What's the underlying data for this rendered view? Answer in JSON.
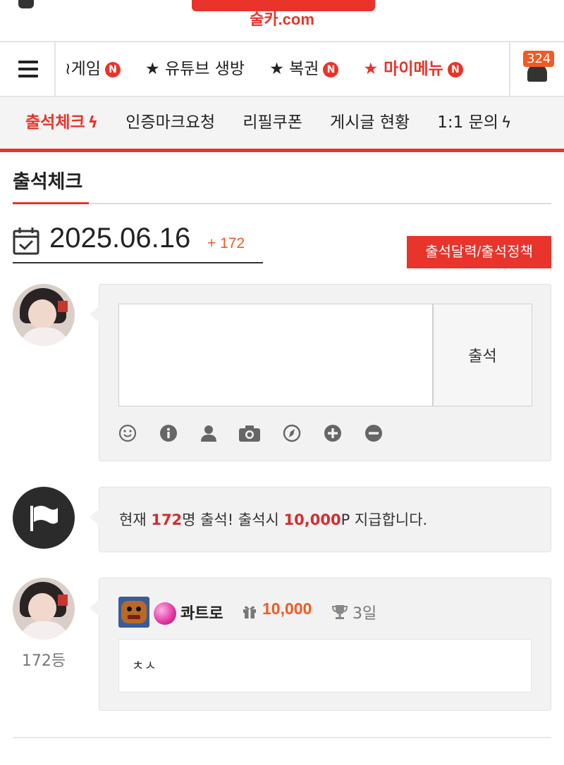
{
  "brand": {
    "domain": "술카.com",
    "accent": "#e8342a"
  },
  "nav1": {
    "items": [
      {
        "label": "≀게임",
        "new": "N",
        "highlight": false
      },
      {
        "label": "★ 유튜브 생방",
        "new": "",
        "highlight": false
      },
      {
        "label": "★ 복권",
        "new": "N",
        "highlight": false
      },
      {
        "label": "★ 마이메뉴",
        "new": "N",
        "highlight": true
      }
    ],
    "notification_count": "324"
  },
  "nav2": {
    "items": [
      {
        "label": "출석체크",
        "active": true,
        "bolt": true
      },
      {
        "label": "인증마크요청",
        "active": false,
        "bolt": false
      },
      {
        "label": "리필쿠폰",
        "active": false,
        "bolt": false
      },
      {
        "label": "게시글 현황",
        "active": false,
        "bolt": false
      },
      {
        "label": "1:1 문의",
        "active": false,
        "bolt": true
      }
    ]
  },
  "page": {
    "title": "출석체크",
    "date": "2025.06.16",
    "count_delta": "+ 172",
    "policy_button": "출석달력/출석정책"
  },
  "attendance_form": {
    "input_value": "",
    "submit_label": "출석",
    "tools": [
      "smile-icon",
      "info-icon",
      "user-icon",
      "camera-icon",
      "compass-icon",
      "plus-circle-icon",
      "minus-circle-icon"
    ]
  },
  "notice": {
    "prefix": "현재 ",
    "count": "172",
    "middle": "명 출석! 출석시 ",
    "points": "10,000",
    "suffix": "P 지급합니다."
  },
  "entries": [
    {
      "rank": "172등",
      "nickname": "콰트로",
      "points": "10,000",
      "streak": "3일",
      "comment": "ㅊㅅ"
    }
  ]
}
